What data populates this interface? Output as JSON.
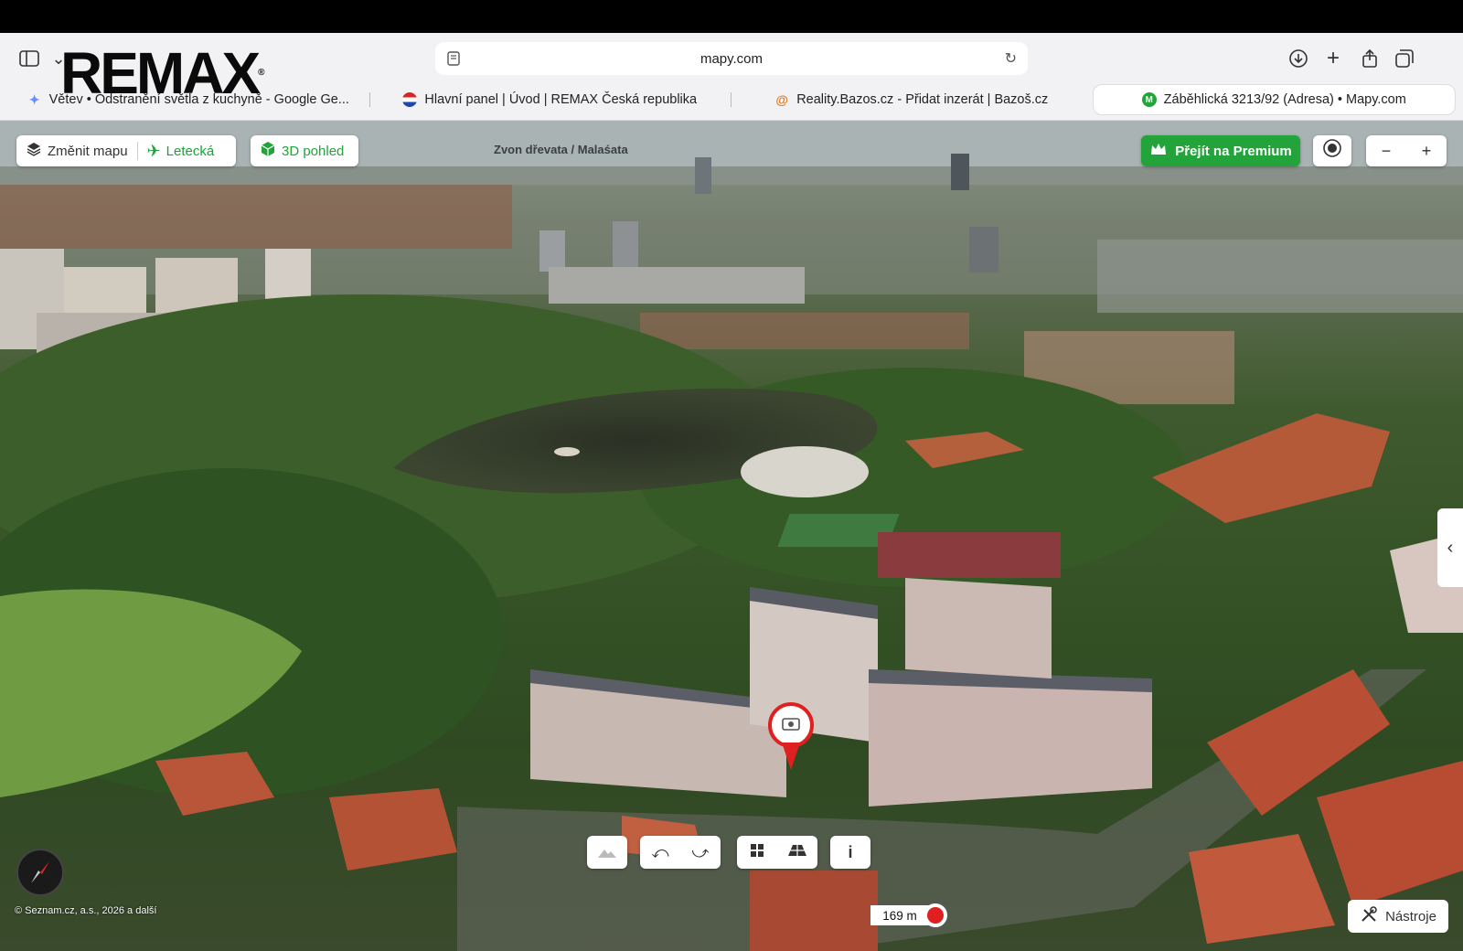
{
  "browser": {
    "url": "mapy.com",
    "tabs": [
      {
        "label": "Větev • Odstranění světla z kuchyně - Google Ge...",
        "active": false
      },
      {
        "label": "Hlavní panel | Úvod | REMAX Česká republika",
        "active": false
      },
      {
        "label": "Reality.Bazos.cz - Přidat inzerát | Bazoš.cz",
        "active": false
      },
      {
        "label": "Záběhlická 3213/92 (Adresa) • Mapy.com",
        "active": true
      }
    ]
  },
  "watermark": {
    "text": "REMAX",
    "reg": "®"
  },
  "map": {
    "change_map_label": "Změnit mapu",
    "aerial_label": "Letecká",
    "view3d_label": "3D pohled",
    "premium_label": "Přejít na Premium",
    "place_label": "Zvon dřevata / Malaśata",
    "tools_label": "Nástroje",
    "scale_label": "169 m",
    "copyright": "© Seznam.cz, a.s., 2026 a další",
    "info_label": "i",
    "colors": {
      "accent_green": "#22a43b",
      "pin_red": "#e02020"
    }
  }
}
